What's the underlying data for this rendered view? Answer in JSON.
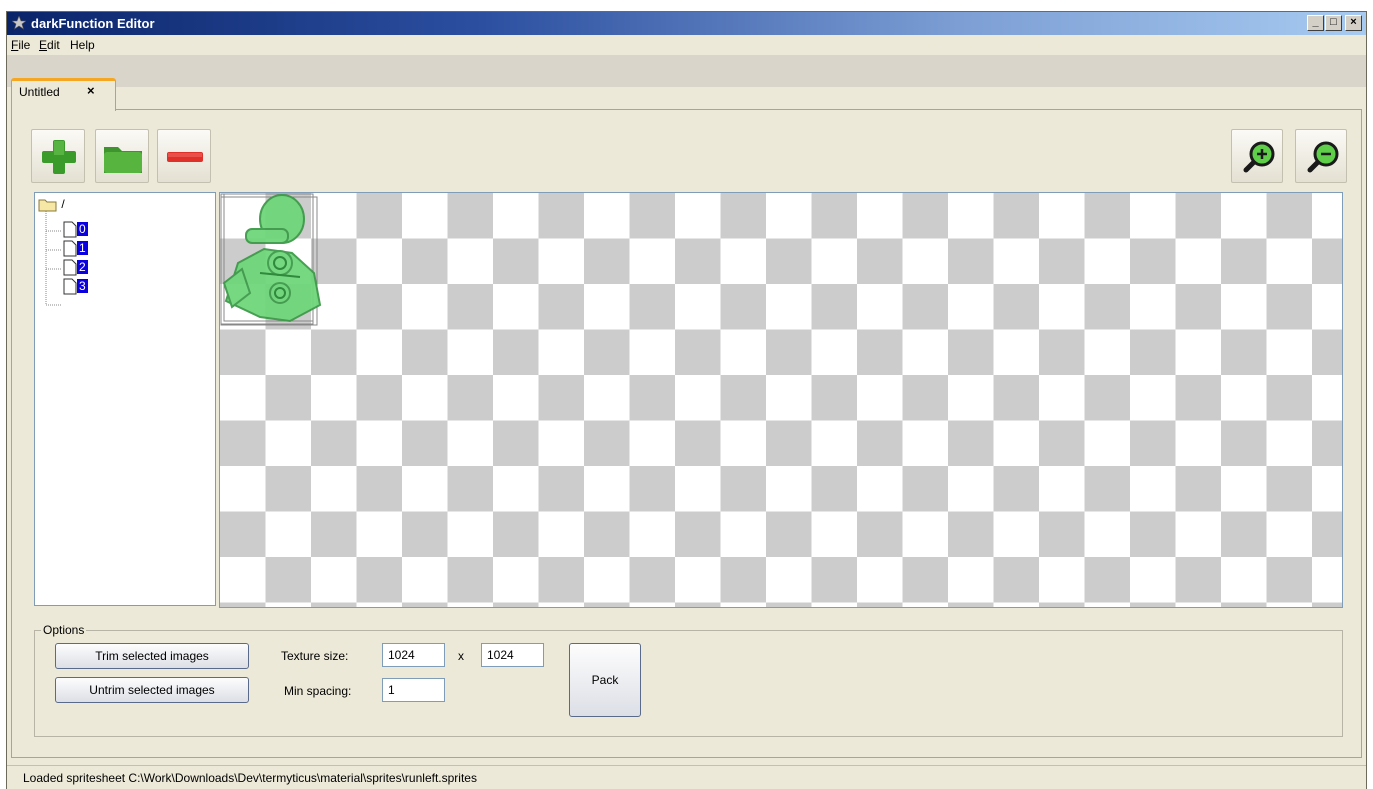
{
  "window": {
    "title": "darkFunction Editor",
    "controls": {
      "minimize": "_",
      "maximize": "□",
      "close": "×"
    }
  },
  "menu": [
    {
      "label": "File",
      "mnemonic": "F",
      "rest": "ile"
    },
    {
      "label": "Edit",
      "mnemonic": "E",
      "rest": "dit"
    },
    {
      "label": "Help",
      "mnemonic": "",
      "rest": "Help"
    }
  ],
  "tabs": [
    {
      "label": "Untitled",
      "close": "×"
    }
  ],
  "toolbar": {
    "left": [
      {
        "name": "add-icon"
      },
      {
        "name": "folder-icon"
      },
      {
        "name": "remove-icon"
      }
    ],
    "right": [
      {
        "name": "zoom-in-icon"
      },
      {
        "name": "zoom-out-icon"
      }
    ]
  },
  "tree": {
    "root": "/",
    "items": [
      "0",
      "1",
      "2",
      "3"
    ]
  },
  "options": {
    "title": "Options",
    "trim_label": "Trim selected images",
    "untrim_label": "Untrim selected images",
    "texture_size_label": "Texture size:",
    "texture_width": "1024",
    "texture_x": "x",
    "texture_height": "1024",
    "min_spacing_label": "Min spacing:",
    "min_spacing": "1",
    "pack_label": "Pack"
  },
  "status": "Loaded spritesheet C:\\Work\\Downloads\\Dev\\termyticus\\material\\sprites\\runleft.sprites",
  "colors": {
    "titlebar_start": "#0a246a",
    "selection": "#0a00e0",
    "tab_accent": "#f5a623",
    "sprite_green": "#6fd67a"
  }
}
